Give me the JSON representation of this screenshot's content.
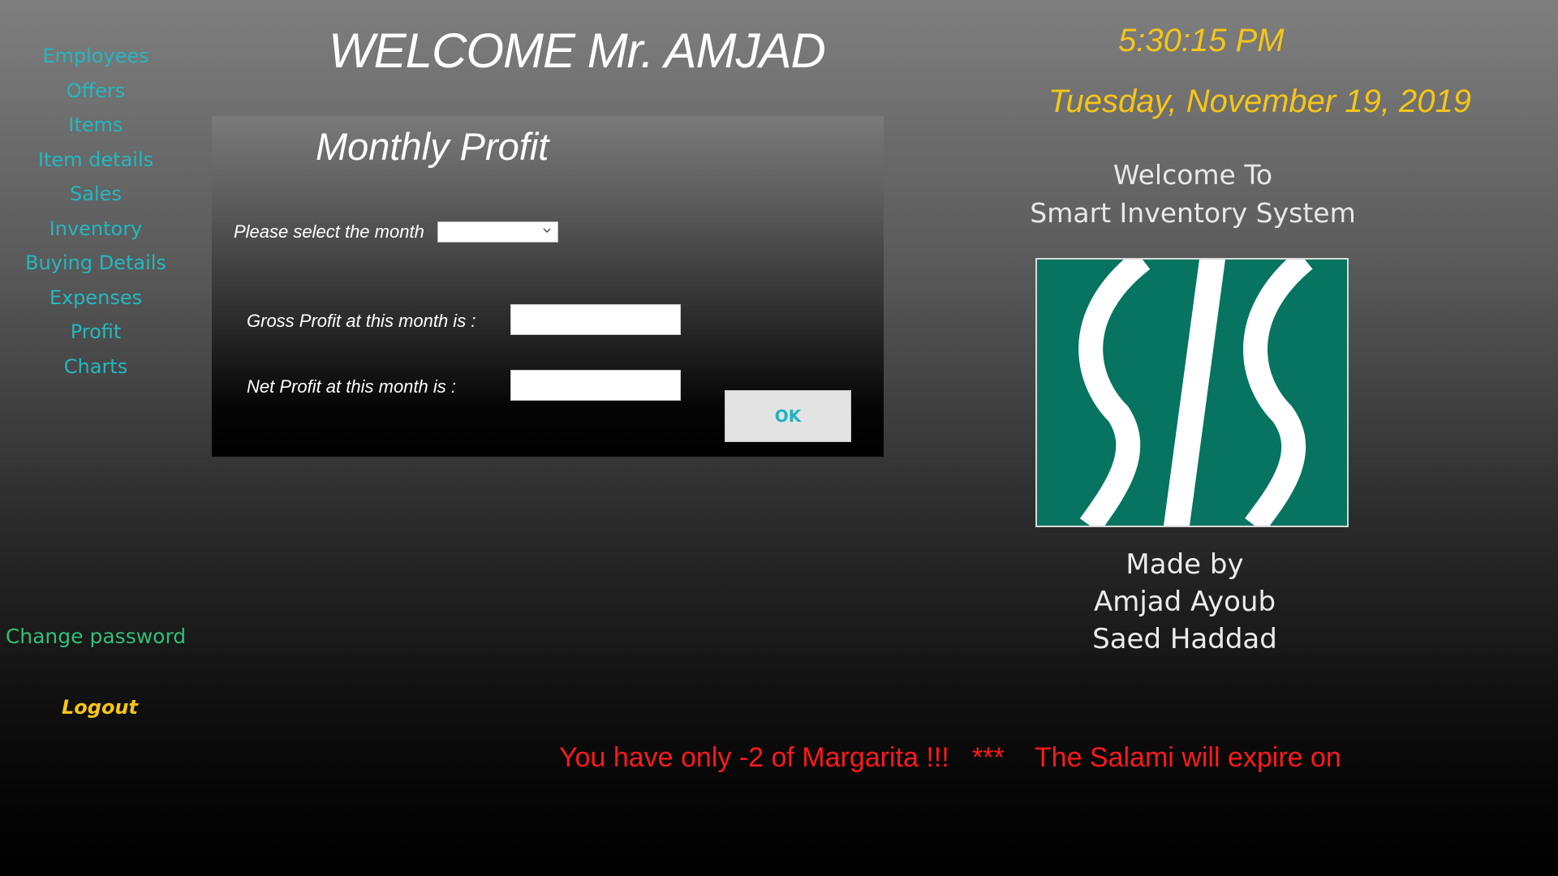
{
  "sidebar": {
    "items": [
      {
        "label": "Employees"
      },
      {
        "label": "Offers"
      },
      {
        "label": "Items"
      },
      {
        "label": "Item details"
      },
      {
        "label": "Sales"
      },
      {
        "label": "Inventory"
      },
      {
        "label": "Buying Details"
      },
      {
        "label": "Expenses"
      },
      {
        "label": "Profit"
      },
      {
        "label": "Charts"
      }
    ],
    "change_password": "Change password",
    "logout": "Logout"
  },
  "header": {
    "welcome": "WELCOME Mr. AMJAD",
    "time": "5:30:15 PM",
    "date": "Tuesday, November 19, 2019"
  },
  "panel": {
    "title": "Monthly Profit",
    "month_label": "Please select the month",
    "month_value": "",
    "gross_label": "Gross Profit at this month is :",
    "gross_value": "",
    "net_label": "Net Profit at this month is :",
    "net_value": "",
    "ok_label": "OK"
  },
  "system": {
    "welcome_line1": "Welcome To",
    "welcome_line2": "Smart Inventory System",
    "logo_text": "SIS",
    "credits_line1": "Made by",
    "credits_line2": "Amjad Ayoub",
    "credits_line3": "Saed Haddad"
  },
  "ticker": {
    "message": "You have only -2 of Margarita !!!   ***    The Salami will expire on"
  },
  "colors": {
    "nav_text": "#23b8c0",
    "accent_yellow": "#f5c518",
    "alert_red": "#ff1a1a",
    "logo_green": "#067460",
    "change_password": "#2fbf7a"
  }
}
